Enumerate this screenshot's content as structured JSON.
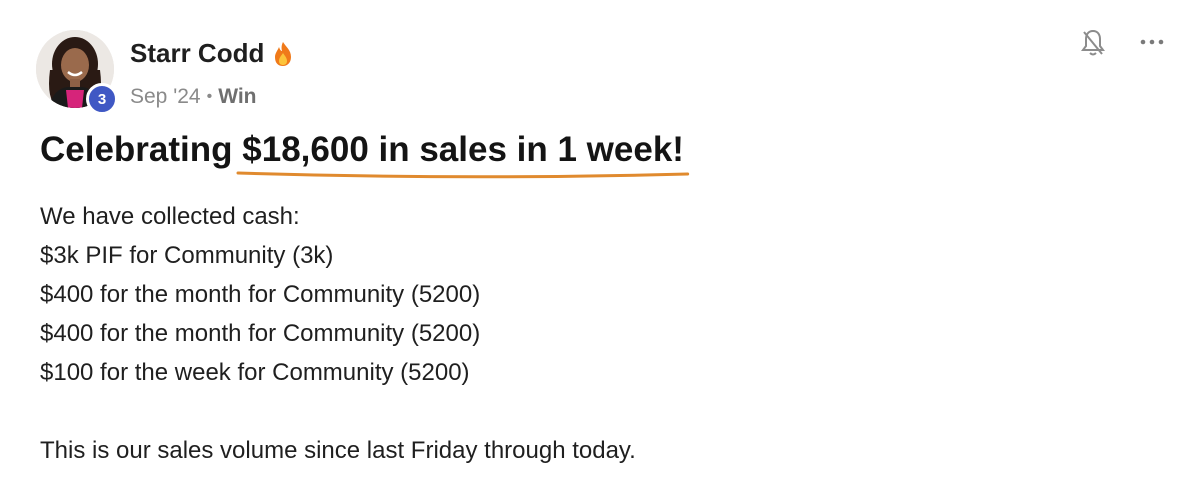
{
  "author": {
    "name": "Starr Codd",
    "level": "3",
    "avatar_icon": "user-avatar-photo",
    "flair_icon": "fire-icon"
  },
  "meta": {
    "date": "Sep '24",
    "separator": "•",
    "category": "Win"
  },
  "actions": {
    "bell_icon": "bell-off-icon",
    "more_icon": "more-horizontal-icon"
  },
  "post": {
    "title_prefix": "Celebrating ",
    "title_highlight": "$18,600 in sales in 1 week!",
    "body_lines": [
      "We have collected cash:",
      "$3k PIF for Community (3k)",
      "$400 for the month for Community (5200)",
      "$400 for the month for Community (5200)",
      "$100 for the week for Community (5200)"
    ],
    "closing": "This is our sales volume since last Friday through today."
  },
  "colors": {
    "accent_underline": "#e08a2e",
    "level_badge": "#3f58c4",
    "meta_text": "#8a8a8a"
  }
}
